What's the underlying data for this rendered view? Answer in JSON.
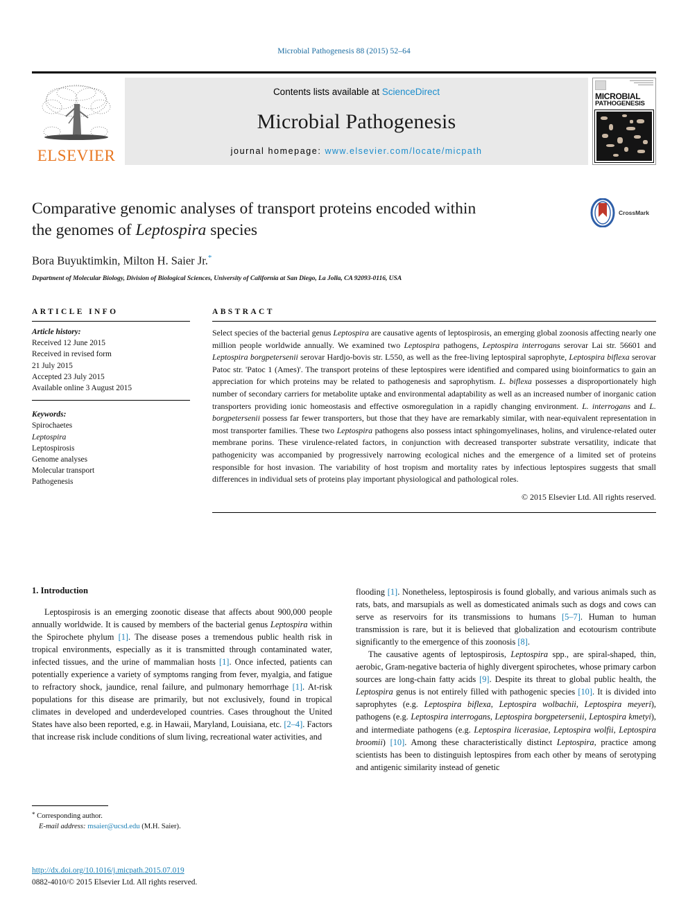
{
  "running_head": "Microbial Pathogenesis 88 (2015) 52–64",
  "masthead": {
    "publisher": "ELSEVIER",
    "contents_prefix": "Contents lists available at ",
    "contents_link": "ScienceDirect",
    "journal_name": "Microbial Pathogenesis",
    "homepage_prefix": "journal homepage: ",
    "homepage_url": "www.elsevier.com/locate/micpath",
    "cover_title_line1": "MICROBIAL",
    "cover_title_line2": "PATHOGENESIS"
  },
  "title": {
    "line1": "Comparative genomic analyses of transport proteins encoded within",
    "line2_prefix": "the genomes of ",
    "line2_italic": "Leptospira",
    "line2_suffix": " species",
    "crossmark_label": "CrossMark"
  },
  "authors": {
    "names": "Bora Buyuktimkin, Milton H. Saier Jr.",
    "corresponding_marker": "*",
    "affiliation": "Department of Molecular Biology, Division of Biological Sciences, University of California at San Diego, La Jolla, CA 92093-0116, USA"
  },
  "article_info": {
    "heading": "ARTICLE INFO",
    "history_label": "Article history:",
    "history": [
      "Received 12 June 2015",
      "Received in revised form",
      "21 July 2015",
      "Accepted 23 July 2015",
      "Available online 3 August 2015"
    ],
    "keywords_label": "Keywords:",
    "keywords": [
      "Spirochaetes",
      "Leptospira",
      "Leptospirosis",
      "Genome analyses",
      "Molecular transport",
      "Pathogenesis"
    ],
    "keywords_italic_index": 1
  },
  "abstract": {
    "heading": "ABSTRACT",
    "text": "Select species of the bacterial genus Leptospira are causative agents of leptospirosis, an emerging global zoonosis affecting nearly one million people worldwide annually. We examined two Leptospira pathogens, Leptospira interrogans serovar Lai str. 56601 and Leptospira borgpetersenii serovar Hardjo-bovis str. L550, as well as the free-living leptospiral saprophyte, Leptospira biflexa serovar Patoc str. 'Patoc 1 (Ames)'. The transport proteins of these leptospires were identified and compared using bioinformatics to gain an appreciation for which proteins may be related to pathogenesis and saprophytism. L. biflexa possesses a disproportionately high number of secondary carriers for metabolite uptake and environmental adaptability as well as an increased number of inorganic cation transporters providing ionic homeostasis and effective osmoregulation in a rapidly changing environment. L. interrogans and L. borgpetersenii possess far fewer transporters, but those that they have are remarkably similar, with near-equivalent representation in most transporter families. These two Leptospira pathogens also possess intact sphingomyelinases, holins, and virulence-related outer membrane porins. These virulence-related factors, in conjunction with decreased transporter substrate versatility, indicate that pathogenicity was accompanied by progressively narrowing ecological niches and the emergence of a limited set of proteins responsible for host invasion. The variability of host tropism and mortality rates by infectious leptospires suggests that small differences in individual sets of proteins play important physiological and pathological roles.",
    "copyright": "© 2015 Elsevier Ltd. All rights reserved."
  },
  "body": {
    "section_number_title": "1. Introduction",
    "left_paragraph": "Leptospirosis is an emerging zoonotic disease that affects about 900,000 people annually worldwide. It is caused by members of the bacterial genus Leptospira within the Spirochete phylum [1]. The disease poses a tremendous public health risk in tropical environments, especially as it is transmitted through contaminated water, infected tissues, and the urine of mammalian hosts [1]. Once infected, patients can potentially experience a variety of symptoms ranging from fever, myalgia, and fatigue to refractory shock, jaundice, renal failure, and pulmonary hemorrhage [1]. At-risk populations for this disease are primarily, but not exclusively, found in tropical climates in developed and underdeveloped countries. Cases throughout the United States have also been reported, e.g. in Hawaii, Maryland, Louisiana, etc. [2–4]. Factors that increase risk include conditions of slum living, recreational water activities, and",
    "right_paragraph_1": "flooding [1]. Nonetheless, leptospirosis is found globally, and various animals such as rats, bats, and marsupials as well as domesticated animals such as dogs and cows can serve as reservoirs for its transmissions to humans [5–7]. Human to human transmission is rare, but it is believed that globalization and ecotourism contribute significantly to the emergence of this zoonosis [8].",
    "right_paragraph_2": "The causative agents of leptospirosis, Leptospira spp., are spiral-shaped, thin, aerobic, Gram-negative bacteria of highly divergent spirochetes, whose primary carbon sources are long-chain fatty acids [9]. Despite its threat to global public health, the Leptospira genus is not entirely filled with pathogenic species [10]. It is divided into saprophytes (e.g. Leptospira biflexa, Leptospira wolbachii, Leptospira meyeri), pathogens (e.g. Leptospira interrogans, Leptospira borgpetersenii, Leptospira kmetyi), and intermediate pathogens (e.g. Leptospira licerasiae, Leptospira wolfii, Leptospira broomii) [10]. Among these characteristically distinct Leptospira, practice among scientists has been to distinguish leptospires from each other by means of serotyping and antigenic similarity instead of genetic"
  },
  "footnote": {
    "corresponding": "Corresponding author.",
    "email_label": "E-mail address:",
    "email": "msaier@ucsd.edu",
    "email_suffix": "(M.H. Saier)."
  },
  "footer": {
    "doi": "http://dx.doi.org/10.1016/j.micpath.2015.07.019",
    "issn_line": "0882-4010/© 2015 Elsevier Ltd. All rights reserved."
  },
  "colors": {
    "link_blue": "#1a7fb5",
    "sciencedirect_blue": "#1a8ccc",
    "elsevier_orange": "#E87722"
  }
}
